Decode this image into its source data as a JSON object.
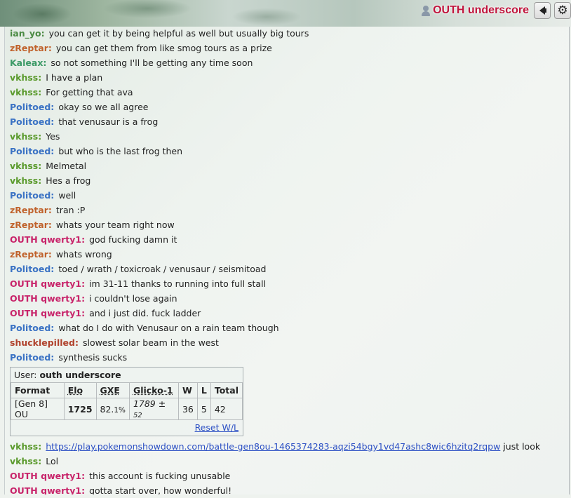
{
  "header": {
    "user_name": "OUTH underscore",
    "user_icon": "user-icon",
    "sound_icon": "speaker-icon",
    "settings_icon": "gear-icon"
  },
  "colors": {
    "ian_yo": "#4b8a43",
    "zReptar": "#c0622c",
    "Kaleax": "#3c9a66",
    "vkhss": "#5a9a2c",
    "Politoed": "#3a72c4",
    "OUTH qwerty1": "#c8246a",
    "shucklepilled": "#b0422c",
    "link": "#2b4fc4"
  },
  "messages_before": [
    {
      "user": "ian_yo:",
      "color": "#4b8a43",
      "text": "you can get it by being helpful as well but usually big tours"
    },
    {
      "user": "zReptar:",
      "color": "#c0622c",
      "text": "you can get them from like smog tours as a prize"
    },
    {
      "user": "Kaleax:",
      "color": "#3c9a66",
      "text": "so not something I'll be getting any time soon"
    },
    {
      "user": "vkhss:",
      "color": "#5a9a2c",
      "text": "I have a plan"
    },
    {
      "user": "vkhss:",
      "color": "#5a9a2c",
      "text": "For getting that ava"
    },
    {
      "user": "Politoed:",
      "color": "#3a72c4",
      "text": "okay so we all agree"
    },
    {
      "user": "Politoed:",
      "color": "#3a72c4",
      "text": "that venusaur is a frog"
    },
    {
      "user": "vkhss:",
      "color": "#5a9a2c",
      "text": "Yes"
    },
    {
      "user": "Politoed:",
      "color": "#3a72c4",
      "text": "but who is the last frog then"
    },
    {
      "user": "vkhss:",
      "color": "#5a9a2c",
      "text": "Melmetal"
    },
    {
      "user": "vkhss:",
      "color": "#5a9a2c",
      "text": "Hes a frog"
    },
    {
      "user": "Politoed:",
      "color": "#3a72c4",
      "text": "well"
    },
    {
      "user": "zReptar:",
      "color": "#c0622c",
      "text": "tran :P"
    },
    {
      "user": "zReptar:",
      "color": "#c0622c",
      "text": "whats your team right now"
    },
    {
      "user": "OUTH qwerty1:",
      "color": "#c8246a",
      "text": "god fucking damn it"
    },
    {
      "user": "zReptar:",
      "color": "#c0622c",
      "text": "whats wrong"
    },
    {
      "user": "Politoed:",
      "color": "#3a72c4",
      "text": "toed / wrath / toxicroak / venusaur / seismitoad"
    },
    {
      "user": "OUTH qwerty1:",
      "color": "#c8246a",
      "text": "im 31-11 thanks to running into full stall"
    },
    {
      "user": "OUTH qwerty1:",
      "color": "#c8246a",
      "text": "i couldn't lose again"
    },
    {
      "user": "OUTH qwerty1:",
      "color": "#c8246a",
      "text": "and i just did. fuck ladder"
    },
    {
      "user": "Politoed:",
      "color": "#3a72c4",
      "text": "what do I do with Venusaur on a rain team though"
    },
    {
      "user": "shucklepilled:",
      "color": "#b0422c",
      "text": "slowest solar beam in the west"
    },
    {
      "user": "Politoed:",
      "color": "#3a72c4",
      "text": "synthesis sucks"
    }
  ],
  "rank_box": {
    "user_label": "User:",
    "user_name": "outh underscore",
    "headers": [
      "Format",
      "Elo",
      "GXE",
      "Glicko-1",
      "W",
      "L",
      "Total"
    ],
    "row": {
      "format": "[Gen 8] OU",
      "elo": "1725",
      "gxe": "82.",
      "gxe_small": "1%",
      "glicko": "1789 ± ",
      "glicko_small": "52",
      "w": "36",
      "l": "5",
      "total": "42"
    },
    "reset_label": "Reset W/L"
  },
  "link_message": {
    "user": "vkhss:",
    "color": "#5a9a2c",
    "link": "https://play.pokemonshowdown.com/battle-gen8ou-1465374283-aqzi54bgy1vd47ashc8wic6hzitq2rqpw",
    "text": " just look"
  },
  "messages_after": [
    {
      "user": "vkhss:",
      "color": "#5a9a2c",
      "text": "Lol"
    },
    {
      "user": "OUTH qwerty1:",
      "color": "#c8246a",
      "text": "this account is fucking unusable"
    },
    {
      "user": "OUTH qwerty1:",
      "color": "#c8246a",
      "text": "gotta start over, how wonderful!"
    }
  ]
}
